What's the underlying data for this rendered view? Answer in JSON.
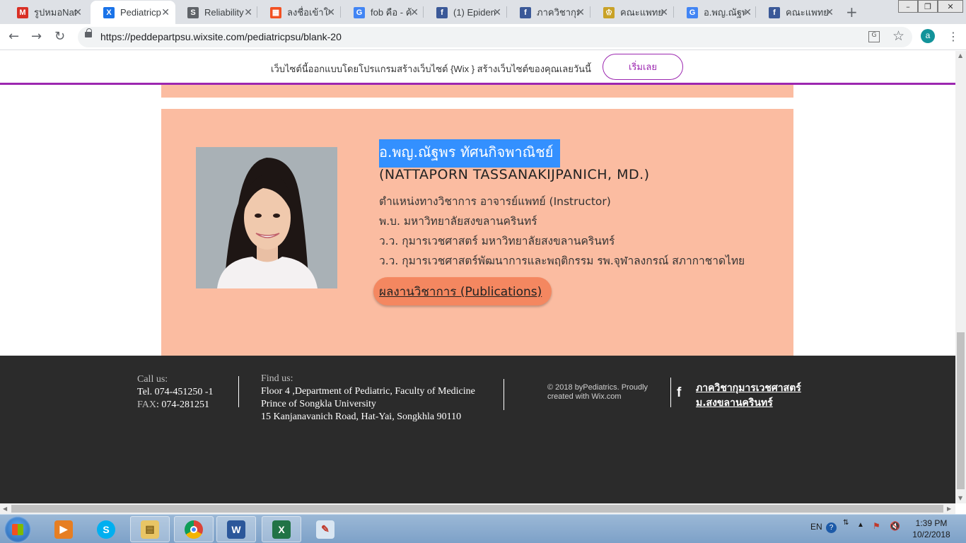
{
  "browser": {
    "tabs": [
      {
        "title": "รูปหมอNat",
        "icon": "gmail-icon",
        "color": "#d93025",
        "glyph": "M"
      },
      {
        "title": "Pediatricp",
        "icon": "wix-icon",
        "color": "#1a73e8",
        "glyph": "X",
        "active": true
      },
      {
        "title": "Reliability",
        "icon": "link-icon",
        "color": "#5f6368",
        "glyph": "S"
      },
      {
        "title": "ลงชื่อเข้าใช้",
        "icon": "microsoft-icon",
        "color": "#f25022",
        "glyph": "▦"
      },
      {
        "title": "fob คือ - ค้",
        "icon": "google-icon",
        "color": "#4285f4",
        "glyph": "G"
      },
      {
        "title": "(1) Epiden",
        "icon": "facebook-icon",
        "color": "#3b5998",
        "glyph": "f"
      },
      {
        "title": "ภาควิชากุม",
        "icon": "facebook-icon",
        "color": "#3b5998",
        "glyph": "f"
      },
      {
        "title": "คณะแพทยศ",
        "icon": "university-icon",
        "color": "#c9a227",
        "glyph": "♔"
      },
      {
        "title": "อ.พญ.ณัฐพ",
        "icon": "google-icon",
        "color": "#4285f4",
        "glyph": "G"
      },
      {
        "title": "คณะแพทยศ",
        "icon": "facebook-icon",
        "color": "#3b5998",
        "glyph": "f"
      }
    ],
    "url": "https://peddepartpsu.wixsite.com/pediatricpsu/blank-20",
    "profile_initial": "a"
  },
  "wix_banner": {
    "text": "เว็บไซต์นี้ออกแบบโดยโปรแกรมสร้างเว็บไซต์ {Wix } สร้างเว็บไซต์ของคุณเลยวันนี้",
    "button": "เริ่มเลย"
  },
  "profile": {
    "name_th": "อ.พญ.ณัฐพร ทัศนกิจพาณิชย์",
    "name_en": "(NATTAPORN TASSANAKIJPANICH, MD.)",
    "details": [
      "ตำแหน่งทางวิชาการ อาจารย์แพทย์ (Instructor)",
      "พ.บ. มหาวิทยาลัยสงขลานครินทร์",
      "ว.ว. กุมารเวชศาสตร์ มหาวิทยาลัยสงขลานครินทร์",
      "ว.ว. กุมารเวชศาสตร์พัฒนาการและพฤติกรรม รพ.จุฬาลงกรณ์ สภากาชาดไทย"
    ],
    "publications_button": "ผลงานวิชาการ (Publications)"
  },
  "footer": {
    "call_label": "Call us:",
    "tel": "Tel. 074-451250 -1",
    "fax_label": "FAX",
    "fax": ": 074-281251",
    "find_label": "Find us:",
    "address": [
      "Floor 4 ,Department of Pediatric, Faculty of Medicine",
      "Prince of Songkla University",
      "15 Kanjanavanich Road, Hat-Yai, Songkhla 90110"
    ],
    "copyright_1": "© 2018 byPediatrics. Proudly",
    "copyright_2": "created with Wix.com",
    "fb_link_1": "ภาควิชากุมารเวชศาสตร์",
    "fb_link_2": "ม.สงขลานครินทร์"
  },
  "taskbar": {
    "language": "EN",
    "time": "1:39 PM",
    "date": "10/2/2018"
  }
}
